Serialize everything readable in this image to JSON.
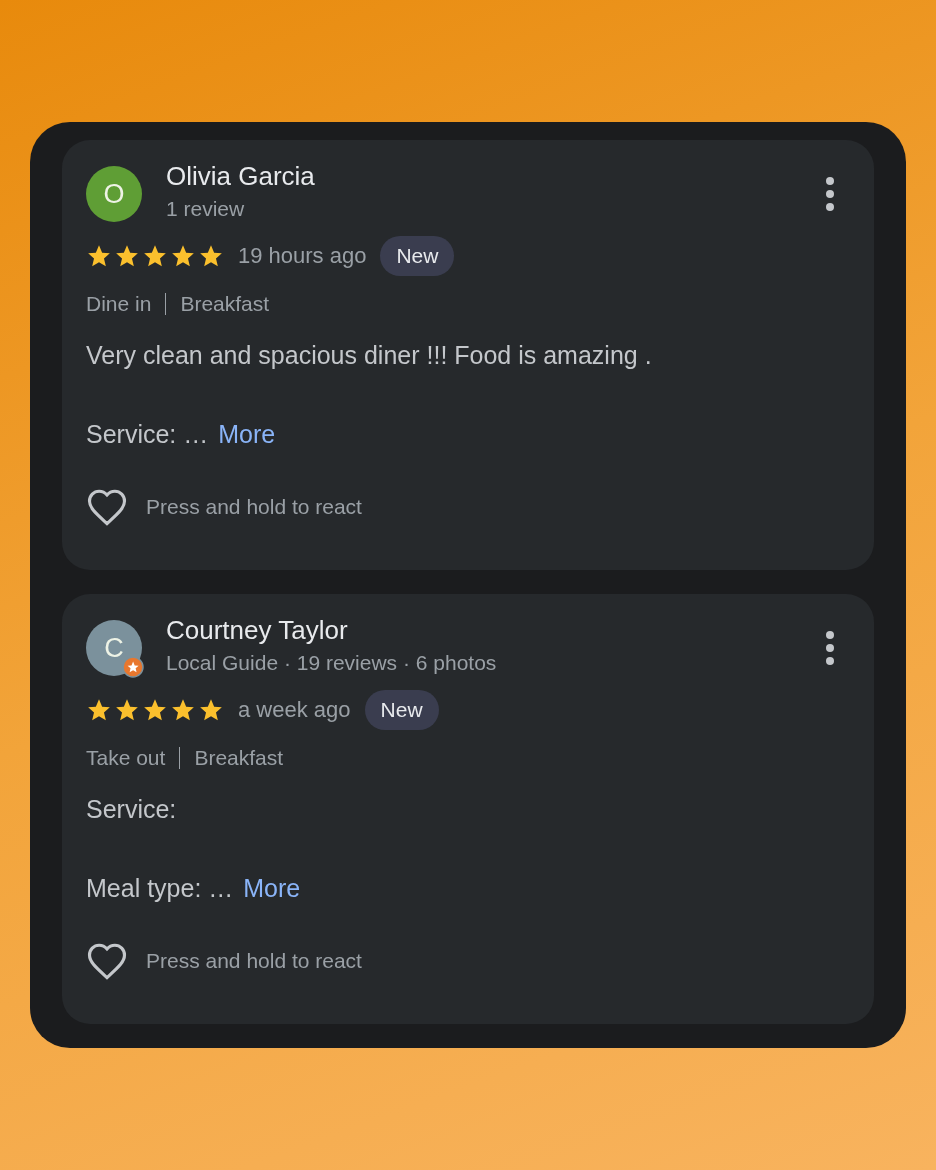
{
  "reviews": [
    {
      "avatar_letter": "O",
      "color": "#5f9e35",
      "local_guide": false,
      "name": "Olivia Garcia",
      "meta": "1 review",
      "stars": 5,
      "time": "19 hours ago",
      "badge": "New",
      "tags": [
        "Dine in",
        "Breakfast"
      ],
      "paragraphs": [
        "Very clean and spacious diner !!! Food is amazing .",
        "Service: …"
      ],
      "more": "More",
      "react": "Press and hold to react"
    },
    {
      "avatar_letter": "C",
      "color": "#7b919c",
      "local_guide": true,
      "name": "Courtney Taylor",
      "meta": "Local Guide · 19 reviews · 6 photos",
      "stars": 5,
      "time": "a week ago",
      "badge": "New",
      "tags": [
        "Take out",
        "Breakfast"
      ],
      "paragraphs": [
        "Service:",
        "Meal type: …"
      ],
      "more": "More",
      "react": "Press and hold to react"
    }
  ]
}
